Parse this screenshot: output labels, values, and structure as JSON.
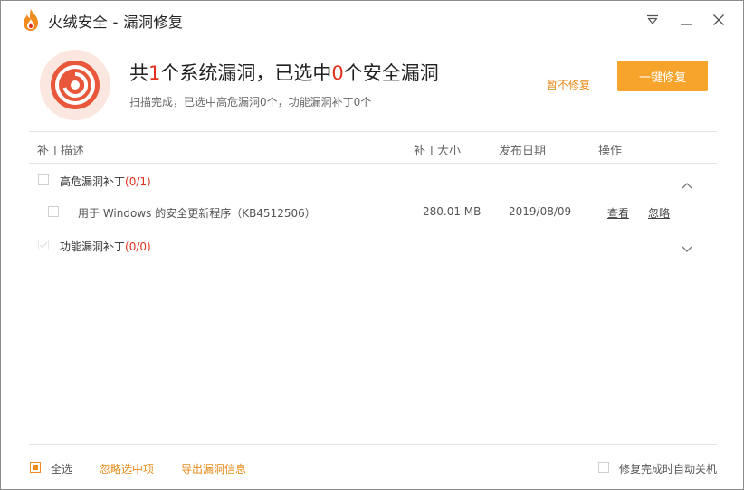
{
  "window": {
    "title": "火绒安全 - 漏洞修复"
  },
  "summary": {
    "title_prefix": "共",
    "total_count": "1",
    "title_mid": "个系统漏洞，已选中",
    "selected_count": "0",
    "title_suffix": "个安全漏洞",
    "subtitle": "扫描完成，已选中高危漏洞0个，功能漏洞补丁0个",
    "skip_label": "暂不修复",
    "fix_button_label": "一键修复"
  },
  "table": {
    "headers": {
      "description": "补丁描述",
      "size": "补丁大小",
      "date": "发布日期",
      "action": "操作"
    },
    "groups": [
      {
        "label": "高危漏洞补丁",
        "count": "(0/1)",
        "checked": false,
        "expanded": true,
        "items": [
          {
            "description": "用于 Windows 的安全更新程序（KB4512506）",
            "size": "280.01 MB",
            "date": "2019/08/09",
            "view_label": "查看",
            "ignore_label": "忽略",
            "checked": false
          }
        ]
      },
      {
        "label": "功能漏洞补丁",
        "count": "(0/0)",
        "checked": true,
        "expanded": false,
        "items": []
      }
    ]
  },
  "footer": {
    "select_all_label": "全选",
    "ignore_selected_label": "忽略选中项",
    "export_label": "导出漏洞信息",
    "auto_shutdown_label": "修复完成时自动关机",
    "select_all_checked": true,
    "auto_shutdown_checked": false
  },
  "colors": {
    "accent": "#f7a42c",
    "highlight_red": "#e0301e",
    "link_orange": "#e78a1a",
    "logo_bg": "#fbe6e0",
    "logo_fg": "#e8573a"
  },
  "icons": [
    "flame-logo-icon",
    "menu-dropdown-icon",
    "minimize-icon",
    "close-icon",
    "vulnerability-shield-icon",
    "chevron-up-icon",
    "chevron-down-icon"
  ]
}
